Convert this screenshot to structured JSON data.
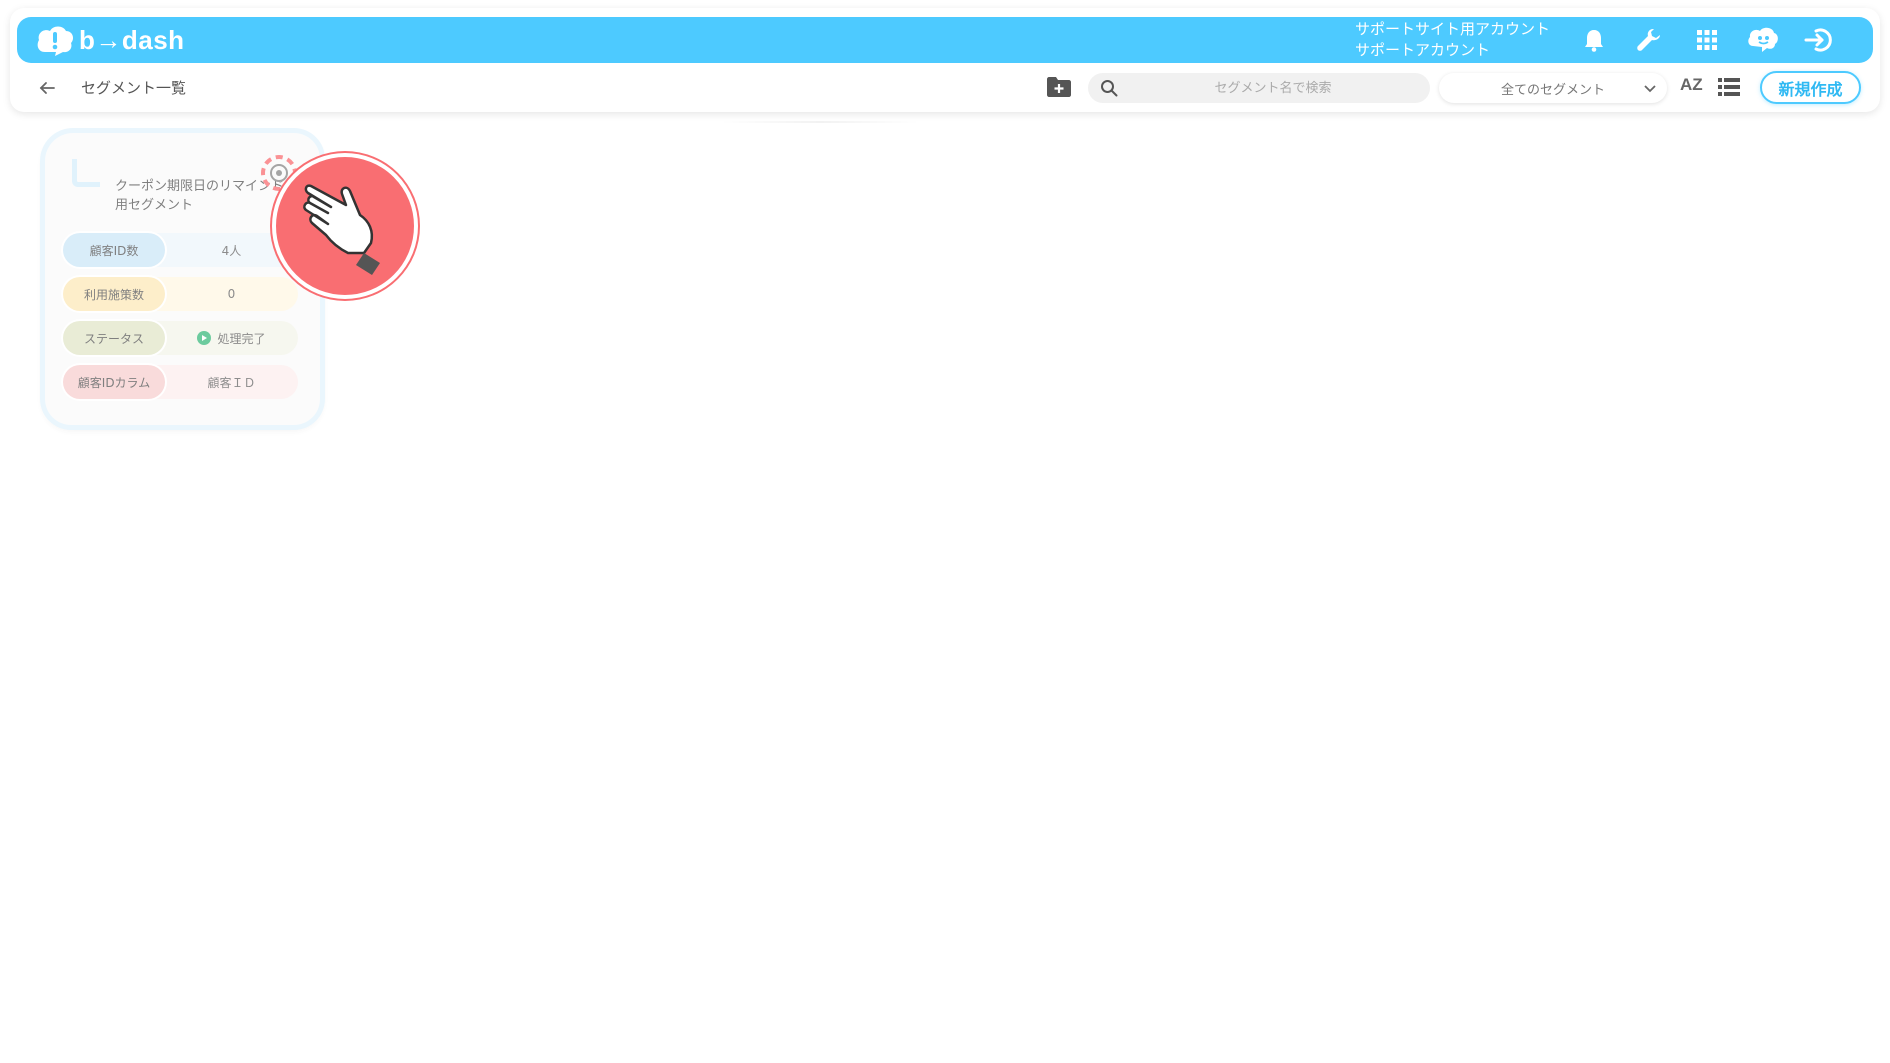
{
  "app": {
    "logo_text": "b→dash",
    "account_line1": "サポートサイト用アカウント",
    "account_line2": "サポートアカウント",
    "brand_color": "#4dcaff"
  },
  "topbar_icons": [
    "bell-icon",
    "wrench-icon",
    "apps-grid-icon",
    "chat-bot-icon",
    "logout-icon"
  ],
  "toolbar": {
    "back_icon": "arrow-left-icon",
    "page_title": "セグメント一覧",
    "search_placeholder": "セグメント名で検索",
    "filter_selected": "全てのセグメント",
    "sort_label": "AZ",
    "new_button": "新規作成"
  },
  "card": {
    "title": "クーポン期限日のリマインド用セグメント",
    "rows": [
      {
        "label": "顧客ID数",
        "value": "4人"
      },
      {
        "label": "利用施策数",
        "value": "0"
      },
      {
        "label": "ステータス",
        "value": "処理完了"
      },
      {
        "label": "顧客IDカラム",
        "value": "顧客ＩＤ"
      }
    ],
    "status_color": "#3cba7e"
  },
  "overlay": {
    "icon": "hand-pointer-icon",
    "color": "#f96e72"
  }
}
